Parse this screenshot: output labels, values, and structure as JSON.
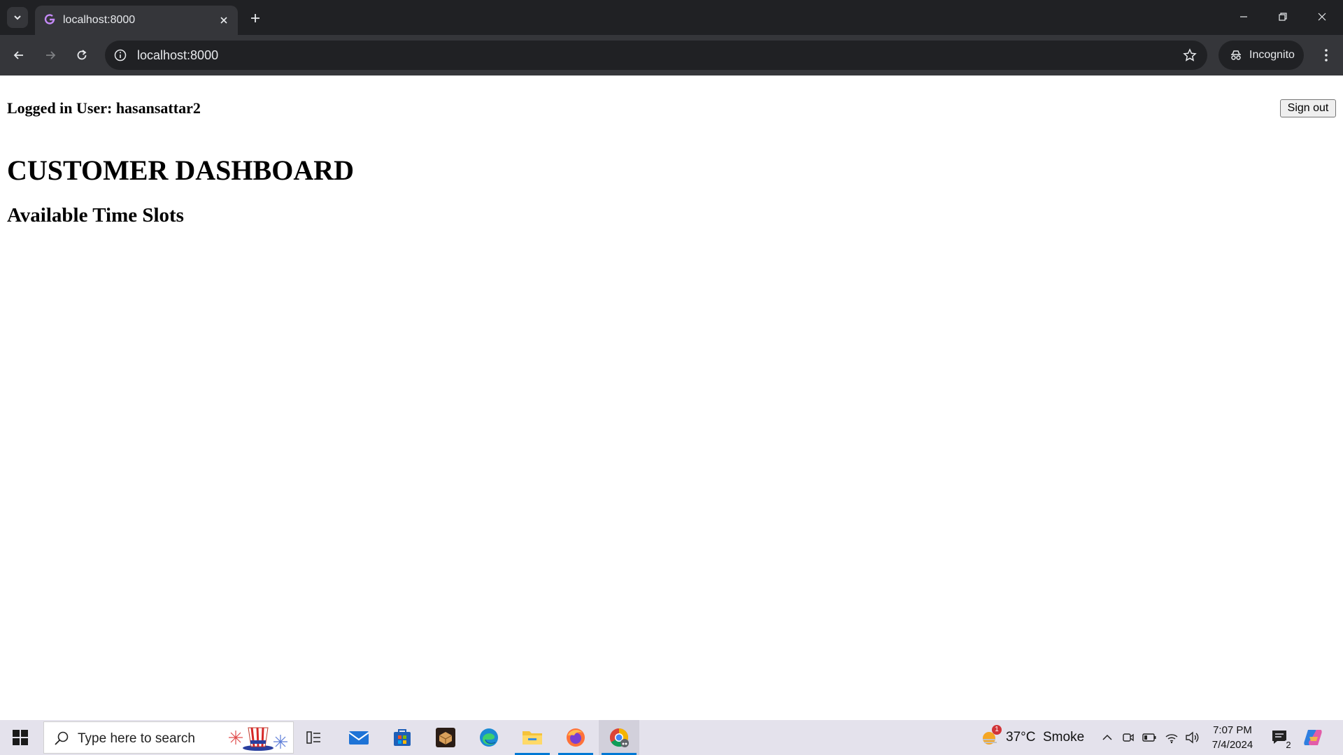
{
  "browser": {
    "tab": {
      "title": "localhost:8000"
    },
    "address_bar": {
      "url": "localhost:8000"
    },
    "profile_label": "Incognito"
  },
  "page": {
    "logged_in_text": "Logged in User: hasansattar2",
    "sign_out_label": "Sign out",
    "title": "CUSTOMER DASHBOARD",
    "section_title": "Available Time Slots"
  },
  "taskbar": {
    "search_placeholder": "Type here to search",
    "weather": {
      "text": "37°C  Smoke",
      "alert_count": "1"
    },
    "clock": {
      "time": "7:07 PM",
      "date": "7/4/2024"
    },
    "notifications_count": "2"
  },
  "colors": {
    "chrome_dark": "#202124",
    "chrome_toolbar": "#35363a",
    "taskbar": "#e4e2ec",
    "accent": "#0078d4"
  }
}
